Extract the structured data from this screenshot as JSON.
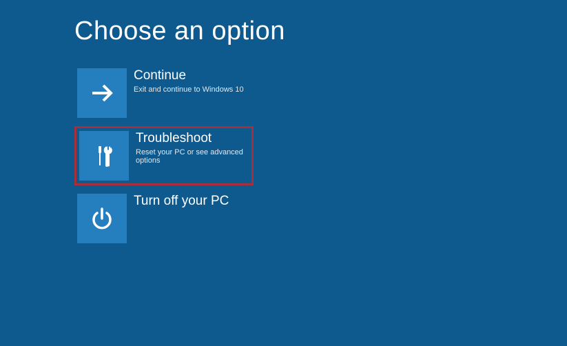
{
  "header": {
    "title": "Choose an option"
  },
  "options": {
    "continue": {
      "title": "Continue",
      "desc": "Exit and continue to Windows 10"
    },
    "troubleshoot": {
      "title": "Troubleshoot",
      "desc": "Reset your PC or see advanced options"
    },
    "turnoff": {
      "title": "Turn off your PC",
      "desc": ""
    }
  },
  "colors": {
    "background": "#0e5a8e",
    "tile": "#257ebd",
    "highlight_border": "#a72e3b"
  }
}
